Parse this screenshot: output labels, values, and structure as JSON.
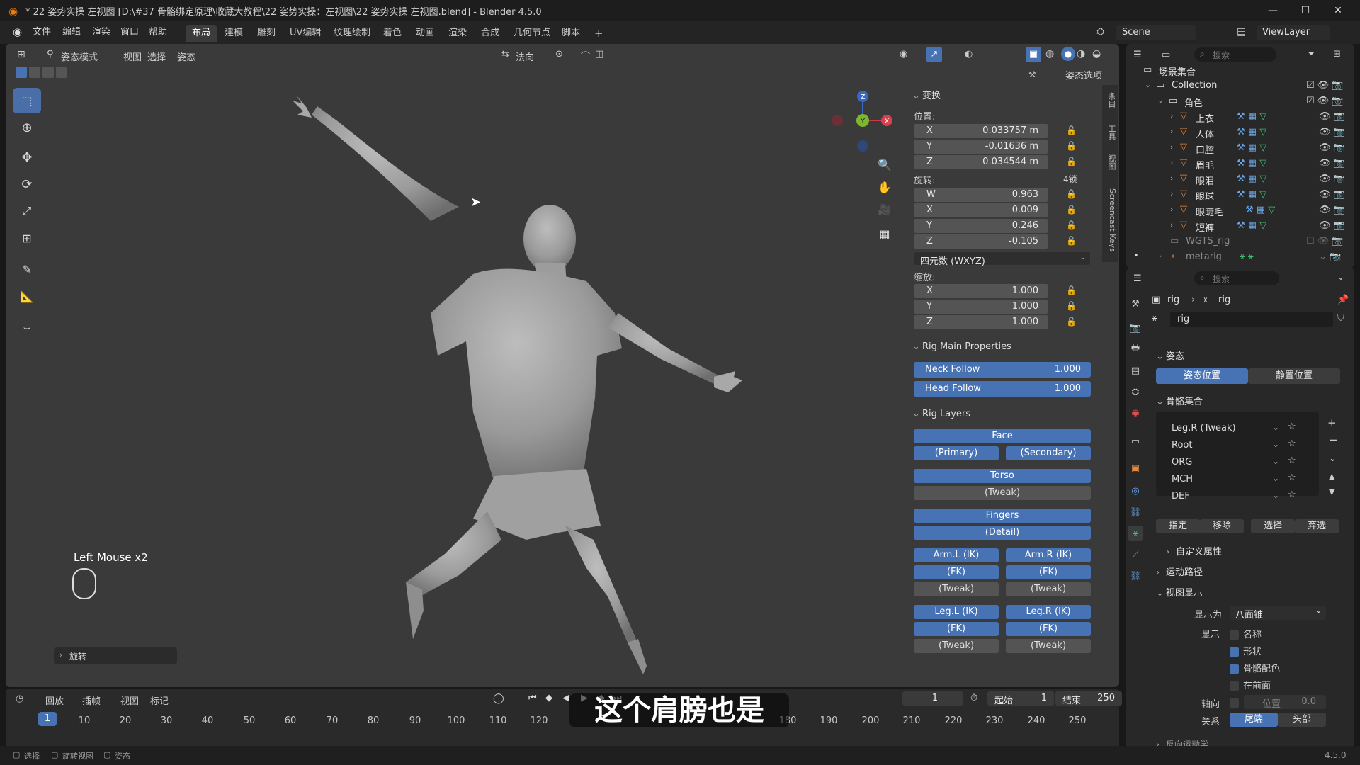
{
  "window": {
    "title": "* 22 姿势实操 左视图 [D:\\#37 骨骼绑定原理\\收藏大教程\\22 姿势实操：左视图\\22 姿势实操 左视图.blend] - Blender 4.5.0",
    "minimize": "—",
    "maximize": "☐",
    "close": "✕"
  },
  "menubar": {
    "file": "文件",
    "edit": "编辑",
    "render": "渲染",
    "window": "窗口",
    "help": "帮助",
    "workspaces": [
      "布局",
      "建模",
      "雕刻",
      "UV编辑",
      "纹理绘制",
      "着色",
      "动画",
      "渲染",
      "合成",
      "几何节点",
      "脚本"
    ],
    "active_workspace": "布局",
    "add_tab": "+",
    "scene": "Scene",
    "view_layer": "ViewLayer"
  },
  "viewport_header": {
    "mode": "姿态模式",
    "view": "视图",
    "select": "选择",
    "pose": "姿态",
    "orientation": "法向",
    "pose_options": "姿态选项"
  },
  "viewport": {
    "gizmo": {
      "z": "Z",
      "y": "Y",
      "x": "X"
    },
    "key_display": "Left Mouse x2",
    "last_op": "旋转"
  },
  "npanel": {
    "tabs": [
      "Screencast Keys",
      "视图",
      "工具",
      "条目"
    ],
    "transform": {
      "title": "变换",
      "location_label": "位置:",
      "location": [
        {
          "axis": "X",
          "value": "0.033757 m"
        },
        {
          "axis": "Y",
          "value": "-0.01636 m"
        },
        {
          "axis": "Z",
          "value": "0.034544 m"
        }
      ],
      "rotation_label": "旋转:",
      "rotation_lock": "4锁",
      "rotation": [
        {
          "axis": "W",
          "value": "0.963"
        },
        {
          "axis": "X",
          "value": "0.009"
        },
        {
          "axis": "Y",
          "value": "0.246"
        },
        {
          "axis": "Z",
          "value": "-0.105"
        }
      ],
      "rotation_mode": "四元数 (WXYZ)",
      "scale_label": "缩放:",
      "scale": [
        {
          "axis": "X",
          "value": "1.000"
        },
        {
          "axis": "Y",
          "value": "1.000"
        },
        {
          "axis": "Z",
          "value": "1.000"
        }
      ]
    },
    "rig_main": {
      "title": "Rig Main Properties",
      "neck_follow": {
        "label": "Neck Follow",
        "value": "1.000"
      },
      "head_follow": {
        "label": "Head Follow",
        "value": "1.000"
      }
    },
    "rig_layers": {
      "title": "Rig Layers",
      "face": "Face",
      "primary": "(Primary)",
      "secondary": "(Secondary)",
      "torso": "Torso",
      "torso_tweak": "(Tweak)",
      "fingers": "Fingers",
      "detail": "(Detail)",
      "arm_l_ik": "Arm.L (IK)",
      "arm_r_ik": "Arm.R (IK)",
      "arm_l_fk": "(FK)",
      "arm_r_fk": "(FK)",
      "arm_l_tweak": "(Tweak)",
      "arm_r_tweak": "(Tweak)",
      "leg_l_ik": "Leg.L (IK)",
      "leg_r_ik": "Leg.R (IK)",
      "leg_l_fk": "(FK)",
      "leg_r_fk": "(FK)",
      "leg_l_tweak": "(Tweak)",
      "leg_r_tweak": "(Tweak)"
    }
  },
  "outliner": {
    "search_placeholder": "搜索",
    "scene_collection": "场景集合",
    "collection": "Collection",
    "character": "角色",
    "items": [
      "上衣",
      "人体",
      "口腔",
      "眉毛",
      "眼泪",
      "眼球",
      "眼睫毛",
      "短裤"
    ],
    "wgts": "WGTS_rig",
    "metarig": "metarig"
  },
  "properties": {
    "search_placeholder": "搜索",
    "breadcrumb_obj": "rig",
    "breadcrumb_data": "rig",
    "datablock": "rig",
    "pose_section": "姿态",
    "pose_position": "姿态位置",
    "rest_position": "静置位置",
    "bone_collections": "骨骼集合",
    "collections": [
      "Leg.R (Tweak)",
      "Root",
      "ORG",
      "MCH",
      "DEF"
    ],
    "assign": "指定",
    "remove": "移除",
    "select": "选择",
    "deselect": "弃选",
    "custom_props": "自定义属性",
    "motion_paths": "运动路径",
    "viewport_display": "视图显示",
    "display_as_label": "显示为",
    "display_as": "八面锥",
    "show_label": "显示",
    "show_names": "名称",
    "show_shapes": "形状",
    "show_group_colors": "骨骼配色",
    "in_front": "在前面",
    "axes_label": "轴向",
    "axes_position": "位置",
    "axes_value": "0.0",
    "relation_label": "关系",
    "tail": "尾端",
    "head": "头部",
    "inverse_kinematics": "反向运动学"
  },
  "timeline": {
    "playback": "回放",
    "keying": "插帧",
    "view": "视图",
    "marker": "标记",
    "current_frame": "1",
    "start_label": "起始",
    "start": "1",
    "end_label": "结束",
    "end": "250",
    "ticks": [
      "10",
      "20",
      "30",
      "40",
      "50",
      "60",
      "70",
      "80",
      "90",
      "100",
      "110",
      "120",
      "180",
      "190",
      "200",
      "210",
      "220",
      "230",
      "240",
      "250"
    ],
    "frame_marker": "1"
  },
  "status": {
    "select": "选择",
    "rotate_view": "旋转视图",
    "context": "姿态",
    "version": "4.5.0"
  },
  "subtitle": "这个肩膀也是"
}
